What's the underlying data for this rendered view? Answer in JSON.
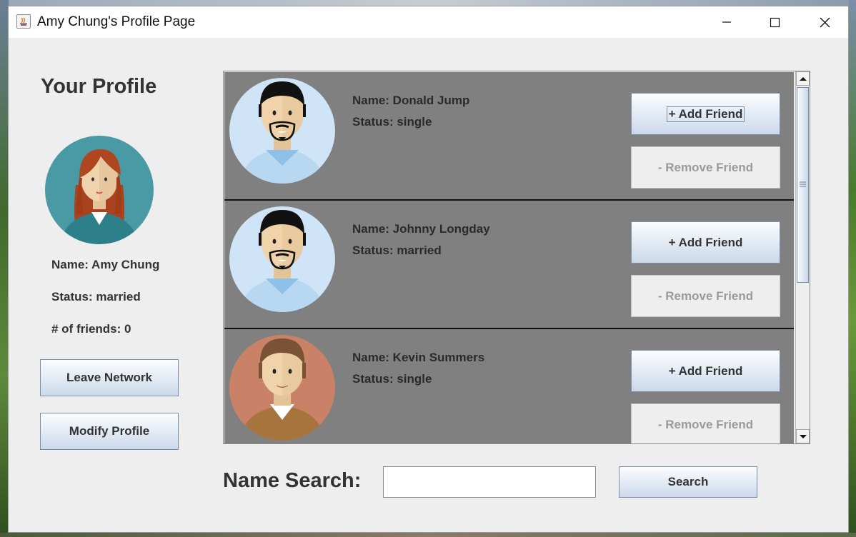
{
  "window": {
    "title": "Amy Chung's Profile Page",
    "controls": [
      "minimize",
      "maximize",
      "close"
    ]
  },
  "profile": {
    "heading": "Your Profile",
    "name_line": "Name: Amy Chung",
    "status_line": "Status: married",
    "friends_line": "# of friends: 0",
    "leave_label": "Leave Network",
    "modify_label": "Modify Profile"
  },
  "people": [
    {
      "name_line": "Name: Donald Jump",
      "status_line": "Status: single",
      "add_label": "+ Add Friend",
      "remove_label": "- Remove Friend",
      "avatar": "man-bearded-avatar-icon"
    },
    {
      "name_line": "Name: Johnny Longday",
      "status_line": "Status: married",
      "add_label": "+ Add Friend",
      "remove_label": "- Remove Friend",
      "avatar": "man-bearded-avatar-icon"
    },
    {
      "name_line": "Name: Kevin Summers",
      "status_line": "Status: single",
      "add_label": "+ Add Friend",
      "remove_label": "- Remove Friend",
      "avatar": "man-brown-hair-avatar-icon"
    }
  ],
  "search": {
    "label": "Name Search:",
    "value": "",
    "placeholder": "",
    "button_label": "Search"
  },
  "colors": {
    "row_background": "#808080",
    "button_gradient_end": "#cbd9ea",
    "window_background": "#eeeeee"
  }
}
